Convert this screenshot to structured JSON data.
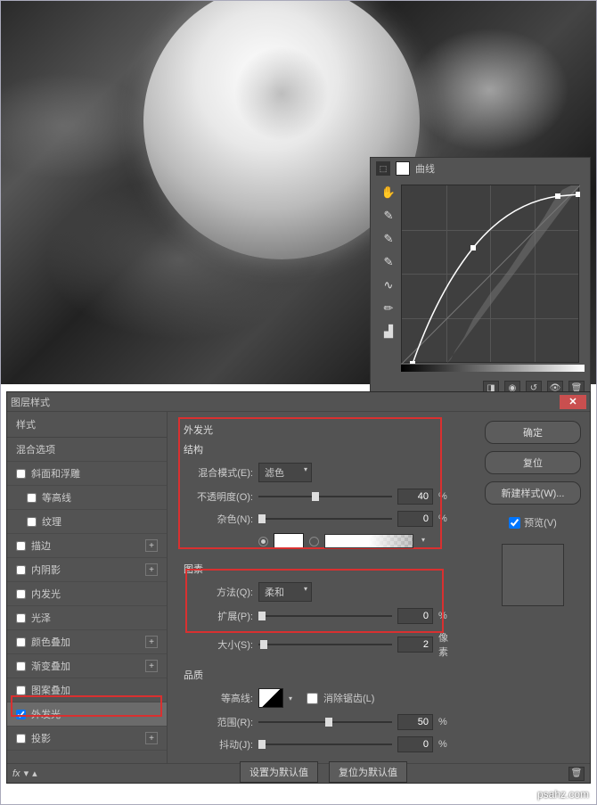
{
  "curves_panel": {
    "title": "曲线"
  },
  "layer_style": {
    "title": "图层样式",
    "left": {
      "header": "样式",
      "blend_options": "混合选项",
      "items": [
        {
          "label": "斜面和浮雕",
          "has_plus": false,
          "indent": false
        },
        {
          "label": "等高线",
          "has_plus": false,
          "indent": true
        },
        {
          "label": "纹理",
          "has_plus": false,
          "indent": true
        },
        {
          "label": "描边",
          "has_plus": true,
          "indent": false
        },
        {
          "label": "内阴影",
          "has_plus": true,
          "indent": false
        },
        {
          "label": "内发光",
          "has_plus": false,
          "indent": false
        },
        {
          "label": "光泽",
          "has_plus": false,
          "indent": false
        },
        {
          "label": "颜色叠加",
          "has_plus": true,
          "indent": false
        },
        {
          "label": "渐变叠加",
          "has_plus": true,
          "indent": false
        },
        {
          "label": "图案叠加",
          "has_plus": false,
          "indent": false
        },
        {
          "label": "外发光",
          "has_plus": false,
          "indent": false,
          "checked": true,
          "selected": true
        },
        {
          "label": "投影",
          "has_plus": true,
          "indent": false
        }
      ]
    },
    "center": {
      "section": "外发光",
      "structure": {
        "title": "结构",
        "blend_mode_label": "混合模式(E):",
        "blend_mode_value": "滤色",
        "opacity_label": "不透明度(O):",
        "opacity_value": "40",
        "noise_label": "杂色(N):",
        "noise_value": "0"
      },
      "elements": {
        "title": "图素",
        "technique_label": "方法(Q):",
        "technique_value": "柔和",
        "spread_label": "扩展(P):",
        "spread_value": "0",
        "size_label": "大小(S):",
        "size_value": "2",
        "size_unit": "像素"
      },
      "quality": {
        "title": "品质",
        "contour_label": "等高线:",
        "antialiased_label": "消除锯齿(L)",
        "range_label": "范围(R):",
        "range_value": "50",
        "jitter_label": "抖动(J):",
        "jitter_value": "0"
      },
      "btn_default": "设置为默认值",
      "btn_reset": "复位为默认值",
      "percent": "%"
    },
    "right": {
      "ok": "确定",
      "cancel": "复位",
      "new_style": "新建样式(W)...",
      "preview": "预览(V)"
    }
  },
  "watermark": "psahz.com"
}
